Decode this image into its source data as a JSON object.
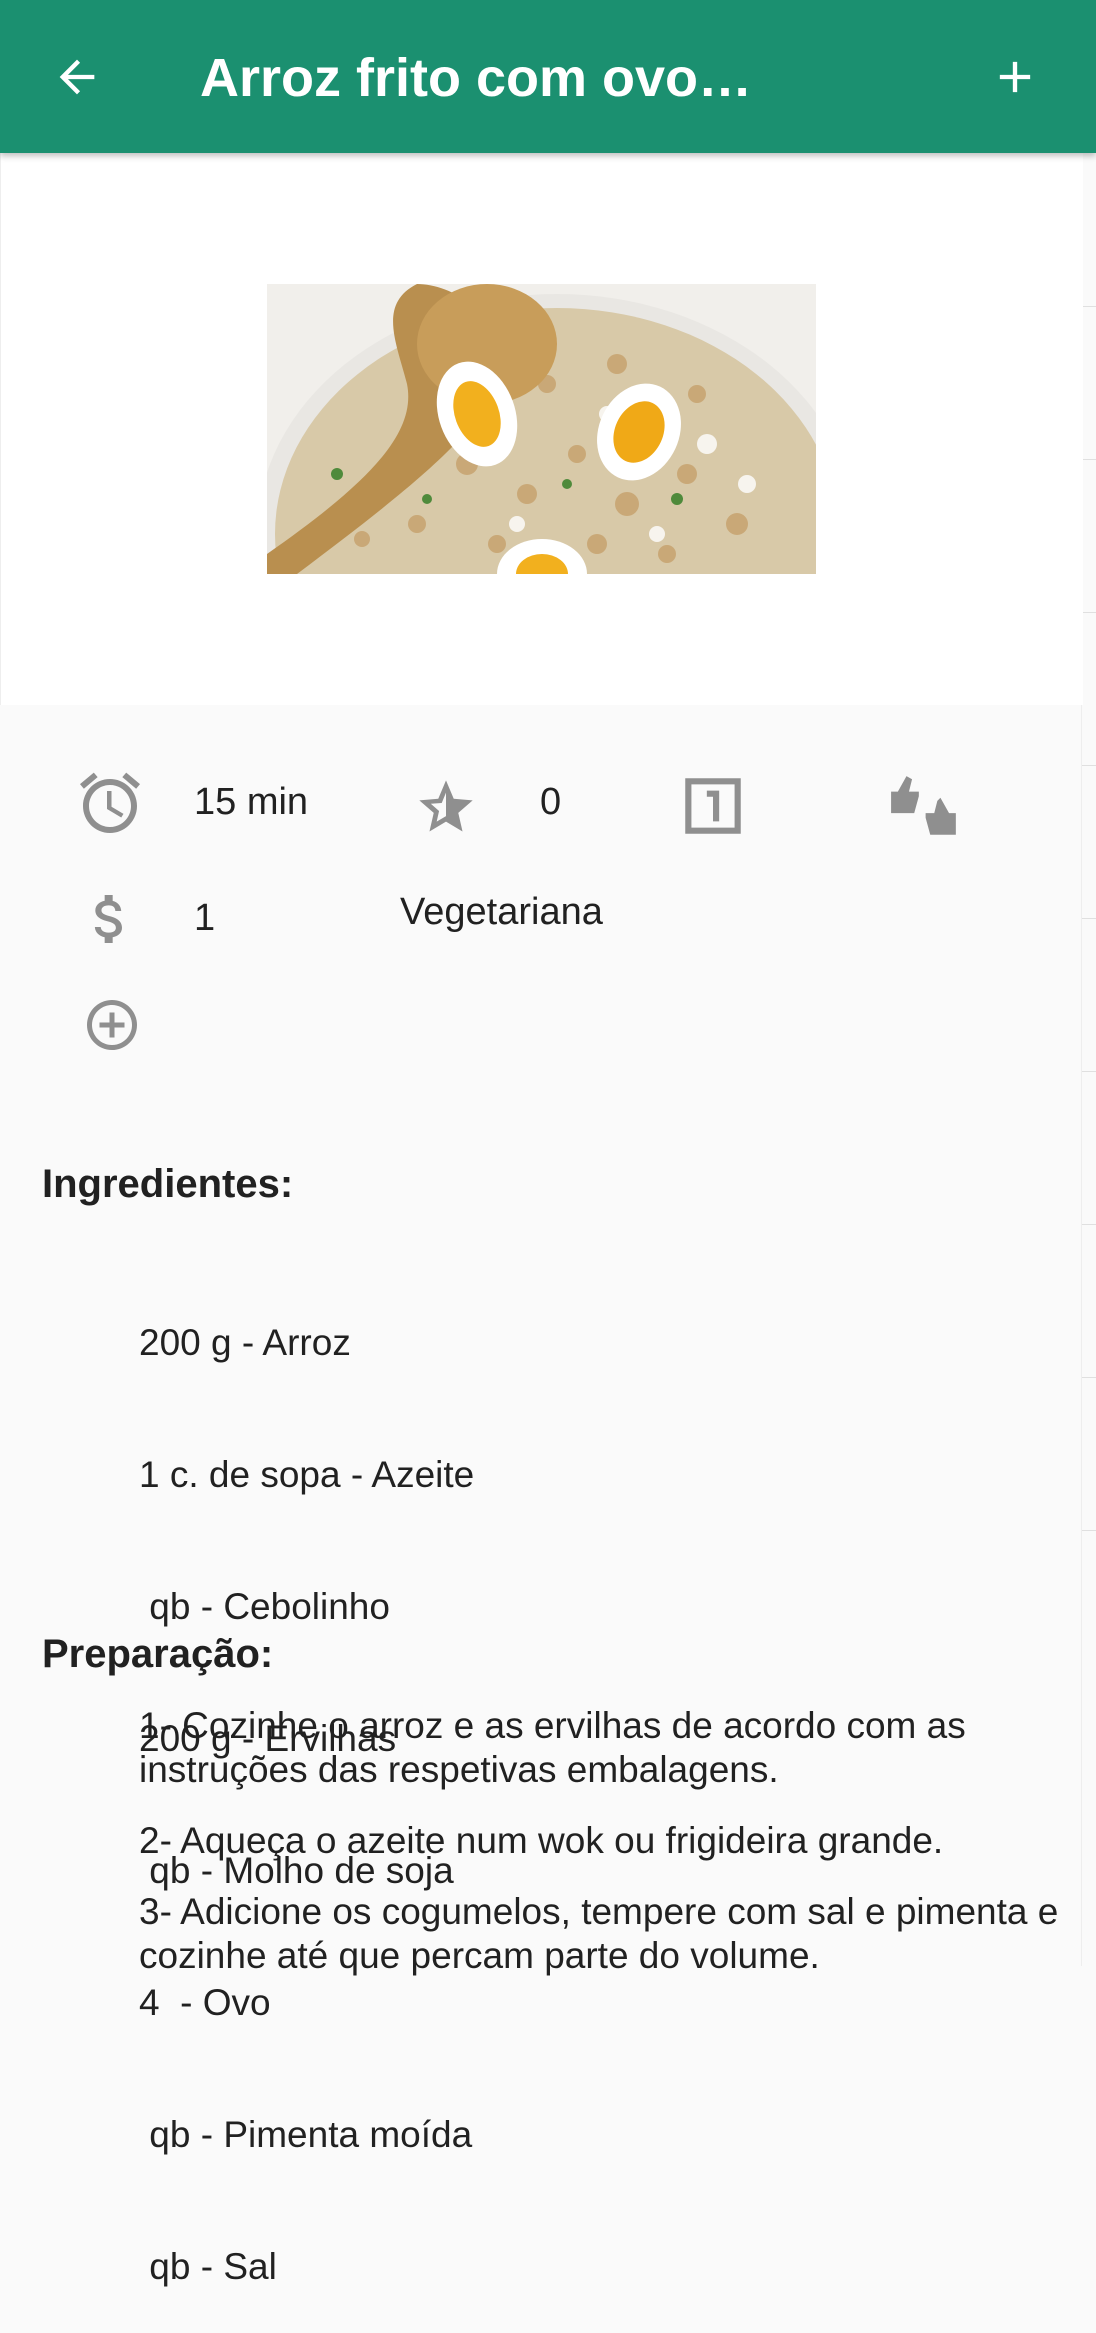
{
  "appbar": {
    "title": "Arroz frito com ovos ...",
    "back_icon": "arrow-left-icon",
    "add_icon": "plus-icon",
    "color": "#1b9070"
  },
  "recipe": {
    "image_alt": "Prato de arroz com ovos cozidos, feijão e bacalhau",
    "time": "15 min",
    "rating": "0",
    "cost": "1",
    "category": "Vegetariana",
    "icons": {
      "time": "alarm-clock-icon",
      "rating": "star-icon",
      "servings": "numbered-box-icon",
      "vote": "thumbs-up-down-icon",
      "cost": "dollar-icon",
      "add_tag": "add-circle-icon"
    }
  },
  "ingredients": {
    "title": "Ingredientes:",
    "items": [
      "200 g - Arroz",
      "1 c. de sopa - Azeite",
      " qb - Cebolinho",
      "200 g - Ervilhas",
      " qb - Molho de soja",
      "4  - Ovo",
      " qb - Pimenta moída",
      " qb - Sal"
    ]
  },
  "preparation": {
    "title": "Preparação:",
    "steps": [
      "1- Cozinhe o arroz e as ervilhas de acordo com as instruções das respetivas embalagens.",
      "2- Aqueça o azeite num wok ou frigideira grande.",
      "3- Adicione os cogumelos, tempere com sal e pimenta e cozinhe até que percam parte do volume."
    ]
  }
}
